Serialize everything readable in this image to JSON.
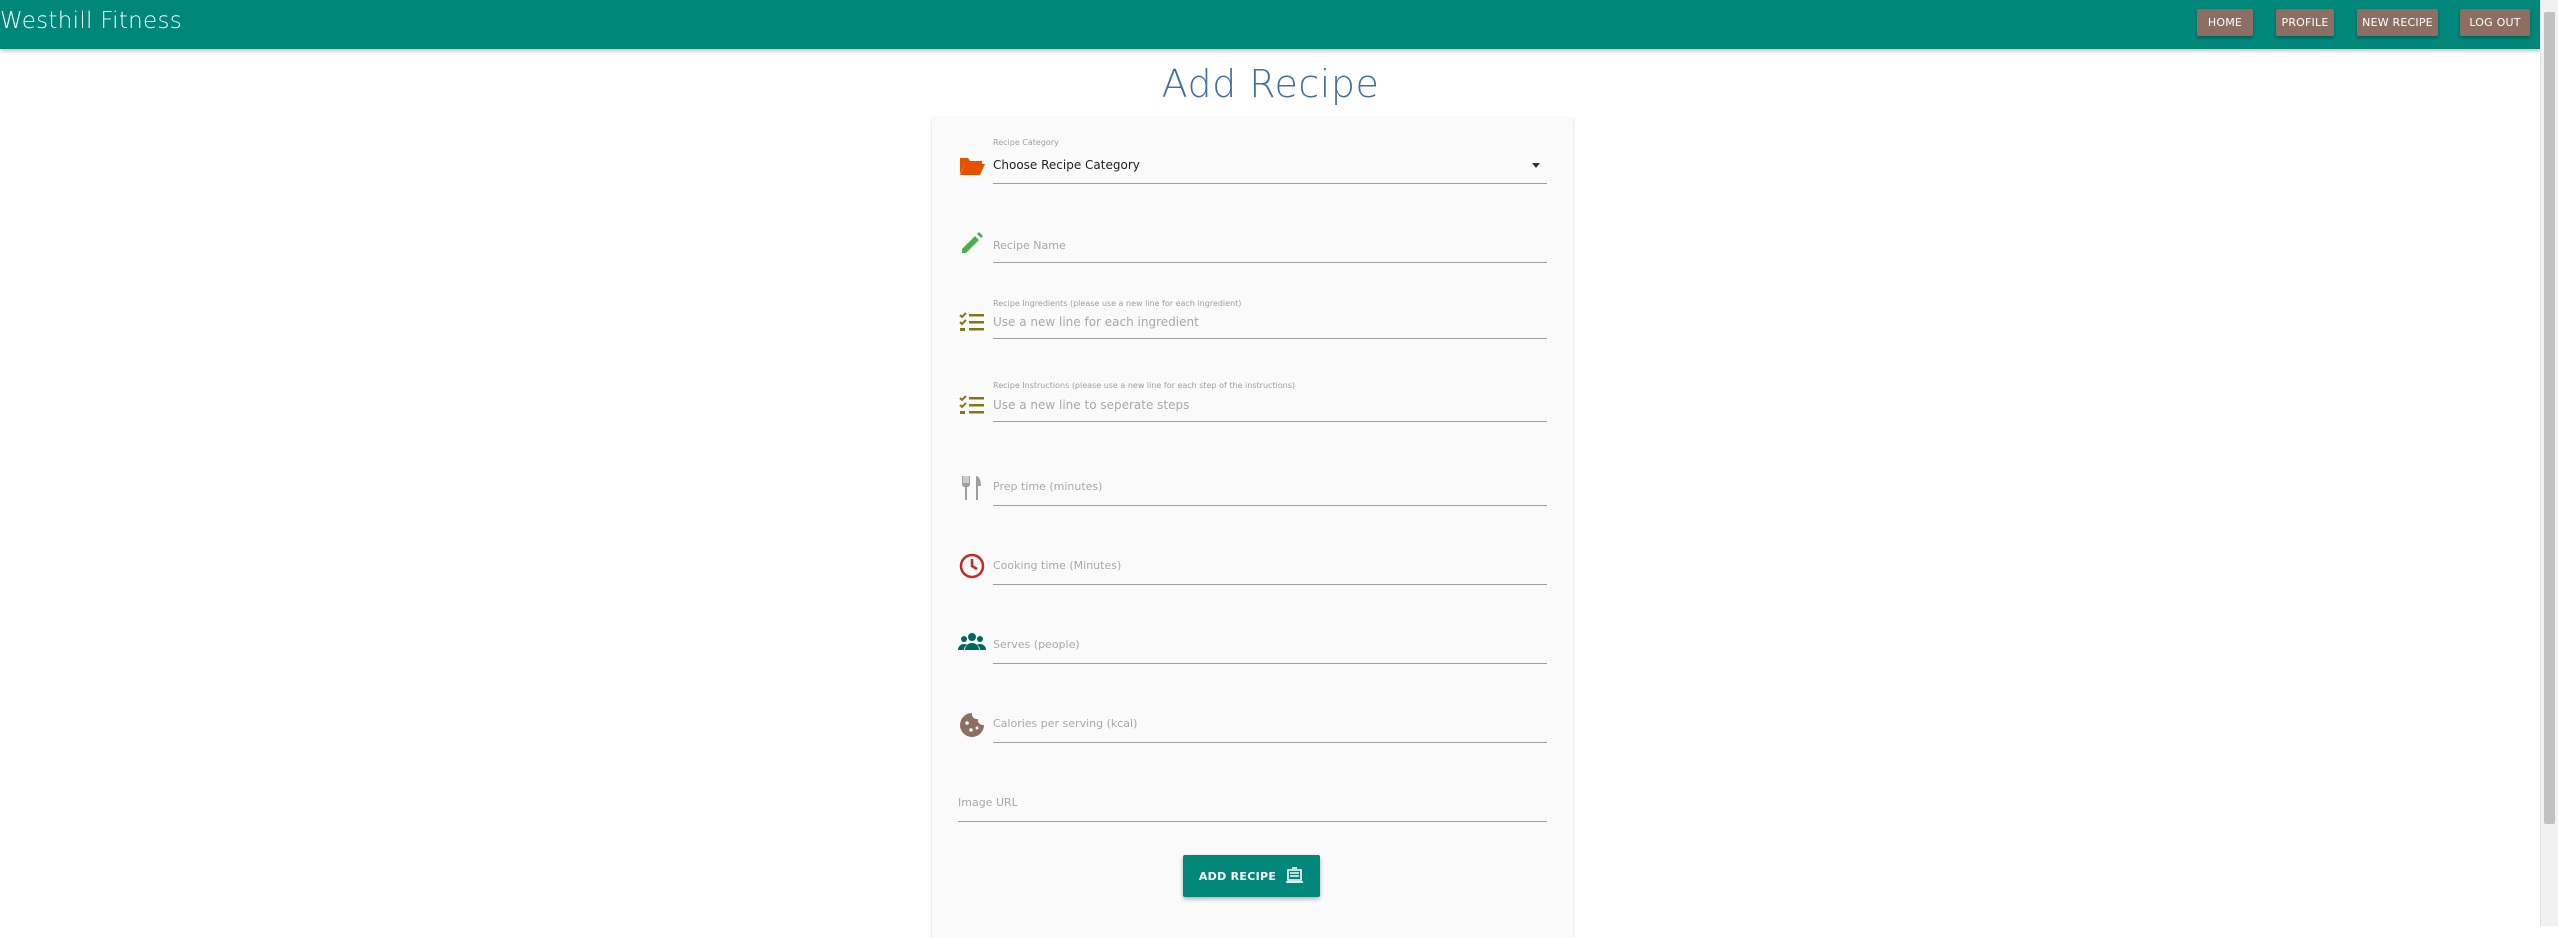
{
  "navbar": {
    "brand": "Westhill Fitness",
    "links": [
      "HOME",
      "PROFILE",
      "NEW RECIPE",
      "LOG OUT"
    ],
    "background_color": "#00877a",
    "button_color": "#8d6e63"
  },
  "page": {
    "title": "Add Recipe",
    "title_color": "#3f6fa4"
  },
  "form": {
    "category": {
      "icon": "folder-open-icon",
      "icon_color": "#e65100",
      "label": "Recipe Category",
      "selected": "Choose Recipe Category"
    },
    "recipe_name": {
      "icon": "pencil-icon",
      "icon_color": "#4caf50",
      "placeholder": "Recipe Name"
    },
    "ingredients": {
      "icon": "checklist-icon",
      "icon_color": "#827717",
      "label": "Recipe Ingredients (please use a new line for each ingredient)",
      "placeholder": "Use a new line for each ingredient"
    },
    "instructions": {
      "icon": "checklist-icon",
      "icon_color": "#827717",
      "label": "Recipe Instructions (please use a new line for each step of the instructions)",
      "placeholder": "Use a new line to seperate steps"
    },
    "prep_time": {
      "icon": "utensils-icon",
      "icon_color": "#9e9e9e",
      "placeholder": "Prep time (minutes)"
    },
    "cooking_time": {
      "icon": "clock-icon",
      "icon_color": "#c62828",
      "placeholder": "Cooking time (Minutes)"
    },
    "serves": {
      "icon": "people-icon",
      "icon_color": "#00695c",
      "placeholder": "Serves (people)"
    },
    "calories": {
      "icon": "cookie-icon",
      "icon_color": "#8d6e63",
      "placeholder": "Calories per serving (kcal)"
    },
    "image_url": {
      "placeholder": "Image URL"
    },
    "submit": {
      "label": "ADD RECIPE",
      "icon": "food-tray-icon"
    }
  }
}
